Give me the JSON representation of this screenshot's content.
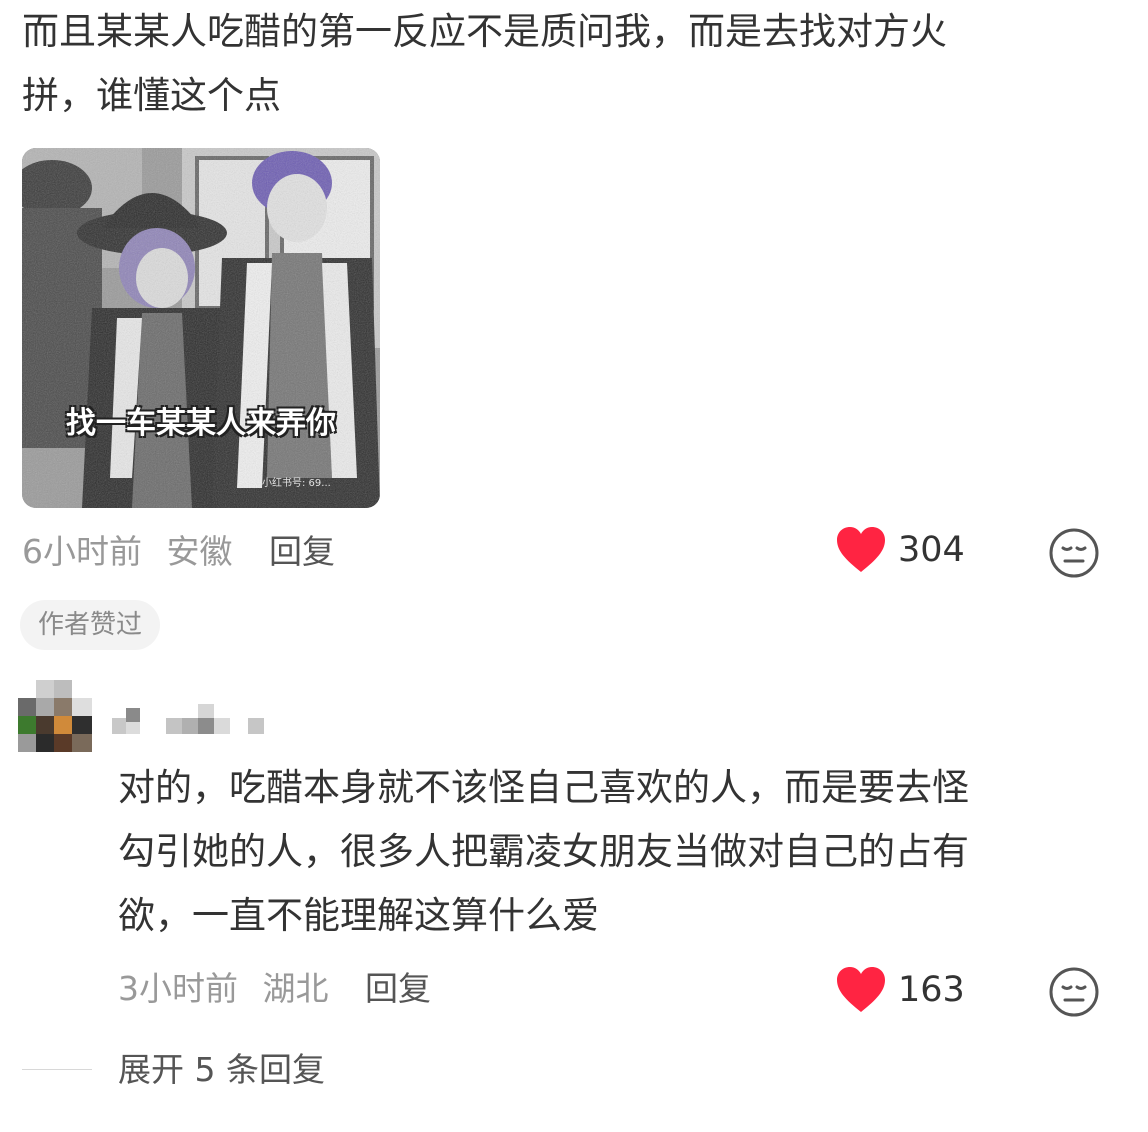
{
  "comment1": {
    "text_line1": "而且某某人吃醋的第一反应不是质问我，而是去找对方火",
    "text_line2": "拼，谁懂这个点",
    "image": {
      "caption": "找一车某某人来弄你",
      "watermark": "小红书号: 69...",
      "description_icon": "anime-meme-image"
    },
    "time": "6小时前",
    "location": "安徽",
    "reply_label": "回复",
    "likes": "304",
    "author_liked_badge": "作者赞过"
  },
  "comment2": {
    "username_masked": "",
    "text_line1": "对的，吃醋本身就不该怪自己喜欢的人，而是要去怪",
    "text_line2": "勾引她的人，很多人把霸凌女朋友当做对自己的占有",
    "text_line3": "欲，一直不能理解这算什么爱",
    "time": "3小时前",
    "location": "湖北",
    "reply_label": "回复",
    "likes": "163"
  },
  "expand_replies": "展开 5 条回复",
  "colors": {
    "heart": "#ff2442",
    "meta_gray": "#999999",
    "text": "#333333"
  }
}
